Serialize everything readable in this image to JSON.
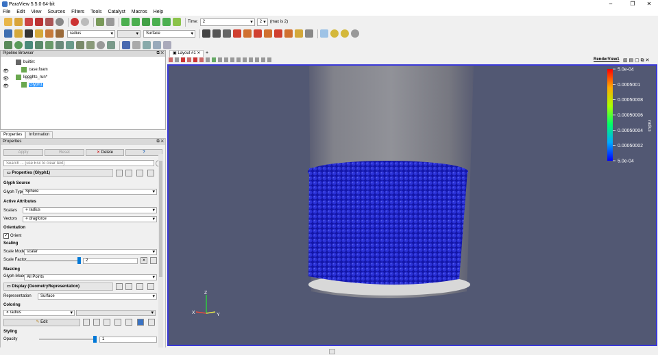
{
  "window": {
    "title": "ParaView 5.5.0 64-bit",
    "minimize": "–",
    "restore": "❐",
    "close": "✕"
  },
  "menu": [
    "File",
    "Edit",
    "View",
    "Sources",
    "Filters",
    "Tools",
    "Catalyst",
    "Macros",
    "Help"
  ],
  "toolbar": {
    "time_label": "Time:",
    "time_value": "2",
    "timestep_value": "2",
    "timestep_max": "(max is 2)",
    "color_array": "radius",
    "representation": "Surface"
  },
  "pipeline": {
    "title": "Pipeline Browser",
    "items": [
      {
        "label": "builtin:"
      },
      {
        "label": "case.foam"
      },
      {
        "label": "liggghts_run*"
      },
      {
        "label": "Glyph1"
      }
    ]
  },
  "tabs": {
    "properties": "Properties",
    "information": "Information"
  },
  "properties": {
    "title": "Properties",
    "apply": "Apply",
    "reset": "Reset",
    "delete": "Delete",
    "help": "?",
    "search_placeholder": "Search ... (use Esc to clear text)",
    "section_properties": "Properties (Glyph1)",
    "glyph_source": "Glyph Source",
    "glyph_type_label": "Glyph Type",
    "glyph_type_value": "Sphere",
    "active_attributes": "Active Attributes",
    "scalars_label": "Scalars",
    "scalars_value": "radius",
    "vectors_label": "Vectors",
    "vectors_value": "dragforce",
    "orientation": "Orientation",
    "orient_label": "Orient",
    "scaling": "Scaling",
    "scale_mode_label": "Scale Mode",
    "scale_mode_value": "scalar",
    "scale_factor_label": "Scale Factor",
    "scale_factor_value": "2",
    "masking": "Masking",
    "glyph_mode_label": "Glyph Mode",
    "glyph_mode_value": "All Points",
    "section_display": "Display (GeometryRepresentation)",
    "representation_label": "Representation",
    "representation_value": "Surface",
    "coloring": "Coloring",
    "coloring_value": "radius",
    "edit": "Edit",
    "styling": "Styling",
    "opacity_label": "Opacity",
    "opacity_value": "1"
  },
  "layout": {
    "tab": "Layout #1",
    "add": "+",
    "view_name": "RenderView1"
  },
  "colorbar": {
    "title": "radius",
    "labels": [
      "5.0e-04",
      "0.0005001",
      "0.00050008",
      "0.00050006",
      "0.00050004",
      "0.00050002",
      "5.0e-04"
    ]
  },
  "axes": {
    "x": "X",
    "y": "Y",
    "z": "Z"
  },
  "colors": {
    "background": "#525873",
    "particles": "#1f25c8",
    "accent": "#3a39d8"
  }
}
